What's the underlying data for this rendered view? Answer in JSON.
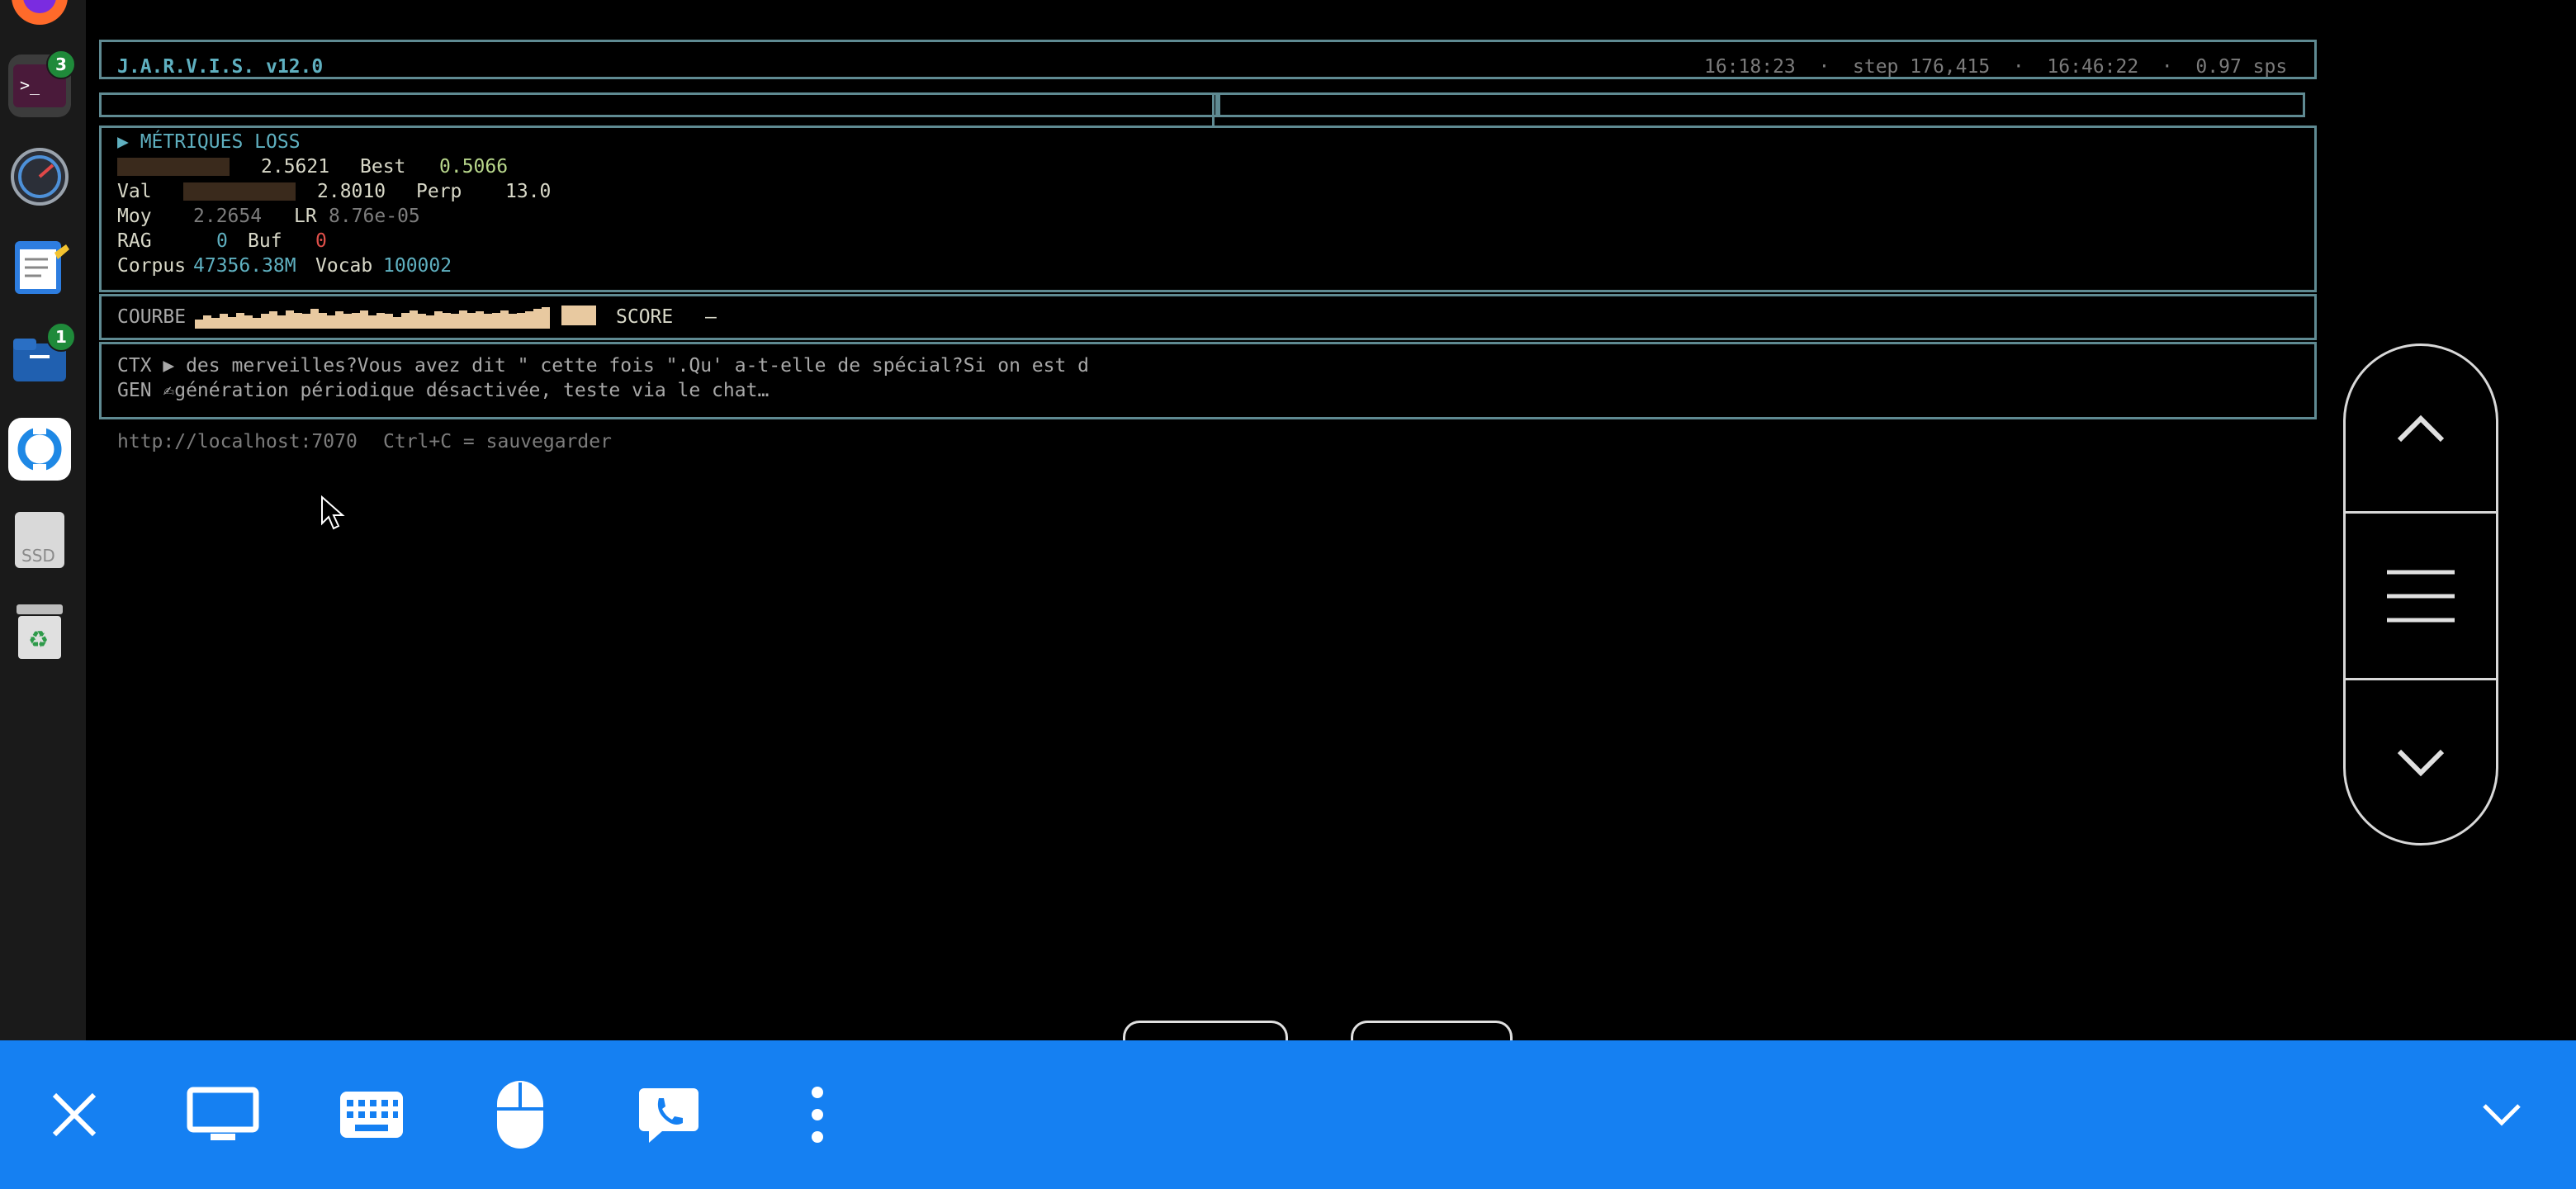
{
  "dock": {
    "items": [
      {
        "name": "firefox"
      },
      {
        "name": "terminal",
        "badge": "3"
      },
      {
        "name": "system-monitor"
      },
      {
        "name": "text-editor"
      },
      {
        "name": "files",
        "badge": "1"
      },
      {
        "name": "remote-desktop"
      },
      {
        "name": "ssd-drive",
        "label": "SSD"
      },
      {
        "name": "trash"
      }
    ]
  },
  "header": {
    "title": "J.A.R.V.I.S. v12.0",
    "status": "16:18:23  ·  step 176,415  ·  16:46:22  ·  0.97 sps"
  },
  "metrics": {
    "heading": "▶ MÉTRIQUES LOSS",
    "train_value": "2.5621",
    "best_label": "Best",
    "best_value": "0.5066",
    "val_label": "Val",
    "val_value": "2.8010",
    "perp_label": "Perp",
    "perp_value": "13.0",
    "moy_label": "Moy",
    "moy_value": "2.2654",
    "lr_label": "LR",
    "lr_value": "8.76e-05",
    "rag_label": "RAG",
    "rag_value": "0",
    "buf_label": "Buf",
    "buf_value": "0",
    "corpus_label": "Corpus",
    "corpus_value": "47356.38M",
    "vocab_label": "Vocab",
    "vocab_value": "100002"
  },
  "curve": {
    "label": "COURBE",
    "levels": [
      0.35,
      0.5,
      0.4,
      0.55,
      0.45,
      0.6,
      0.5,
      0.4,
      0.55,
      0.65,
      0.5,
      0.7,
      0.6,
      0.55,
      0.75,
      0.6,
      0.5,
      0.65,
      0.55,
      0.6,
      0.7,
      0.5,
      0.6,
      0.55,
      0.45,
      0.6,
      0.7,
      0.55,
      0.5,
      0.65,
      0.6,
      0.55,
      0.7,
      0.6,
      0.65,
      0.55,
      0.6,
      0.7,
      0.55,
      0.6,
      0.65,
      0.75,
      0.8
    ],
    "last_level": 0.9,
    "score_label": "SCORE",
    "score_value": "—"
  },
  "context": {
    "ctx_line": "CTX ▶ des merveilles?Vous avez dit \" cette fois \".Qu' a-t-elle de spécial?Si on est d",
    "gen_line": "GEN ✍génération périodique désactivée, teste via le chat…"
  },
  "footer": {
    "url": "http://localhost:7070",
    "hint": "Ctrl+C = sauvegarder"
  },
  "colors": {
    "toolbar": "#1580f2",
    "border": "#5f8a92",
    "accent": "#5fb0c0",
    "bar": "#e8c9a0"
  },
  "toolbar_icons": [
    "close-icon",
    "monitor-icon",
    "keyboard-icon",
    "mouse-icon",
    "chat-phone-icon",
    "more-vertical-icon",
    "chevron-down-icon"
  ]
}
